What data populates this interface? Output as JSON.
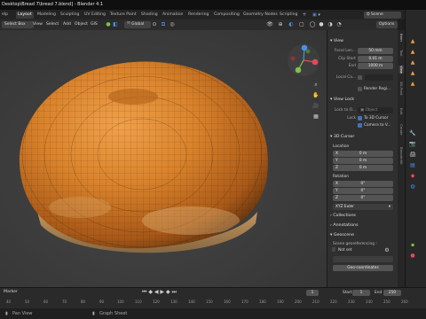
{
  "window": {
    "title": "Desktop\\Bread 7\\bread 7.blend] - Blender 4.1"
  },
  "workspace_tabs": [
    "Layout",
    "Modeling",
    "Sculpting",
    "UV Editing",
    "Texture Paint",
    "Shading",
    "Animation",
    "Rendering",
    "Compositing",
    "Geometry Nodes",
    "Scripting"
  ],
  "active_tab": "Layout",
  "top_right": {
    "scene_label": "Scene"
  },
  "header": {
    "select_box": "Select Box",
    "menus": [
      "View",
      "Select",
      "Add",
      "Object",
      "GIS"
    ],
    "transform_orientation": "Global",
    "options_label": "Options"
  },
  "npanel": {
    "view_section": "View",
    "focal_length_label": "Focal Len...",
    "focal_length_value": "50 mm",
    "clip_start_label": "Clip Start",
    "clip_start_value": "0.01 m",
    "clip_end_label": "End",
    "clip_end_value": "1000 m",
    "local_camera_label": "Local Ca...",
    "render_region_label": "Render Regi...",
    "view_lock_section": "View Lock",
    "lock_to_object_label": "Lock to O...",
    "object_placeholder": "Object",
    "lock_label": "Lock",
    "to_3d_cursor": "To 3D Cursor",
    "camera_to_view": "Camera to V...",
    "cursor_section": "3D Cursor",
    "location_label": "Location",
    "loc_x_label": "X",
    "loc_x": "0 m",
    "loc_y_label": "Y",
    "loc_y": "0 m",
    "loc_z_label": "Z",
    "loc_z": "0 m",
    "rotation_label": "Rotation",
    "rot_x_label": "X",
    "rot_x": "0°",
    "rot_y_label": "Y",
    "rot_y": "0°",
    "rot_z_label": "Z",
    "rot_z": "0°",
    "rotation_mode": "XYZ Euler",
    "collections_section": "Collections",
    "annotations_section": "Annotations",
    "geoscene_section": "Geoscene",
    "geo_label": "Scene georeferencing :",
    "geo_not_set": "Not set",
    "geo_coords_button": "Geo-coordinates",
    "vertical_tabs": [
      "Item",
      "Tool",
      "View",
      "3D-Print",
      "Edit",
      "Create",
      "BlenderKit"
    ]
  },
  "timeline": {
    "marker_menu": "Marker",
    "start_label": "Start",
    "start_value": "1",
    "end_label": "End",
    "end_value": "250",
    "current_frame": "1",
    "ruler": [
      "40",
      "50",
      "60",
      "70",
      "80",
      "90",
      "100",
      "110",
      "120",
      "130",
      "140",
      "150",
      "160",
      "170",
      "180",
      "190",
      "200",
      "210",
      "220",
      "230",
      "240",
      "250",
      "260"
    ]
  },
  "statusbar": {
    "pan_view": "Pan View",
    "graph_label": "Graph Sheet"
  },
  "colors": {
    "accent": "#4772b3",
    "bread_crust": "#d9822b",
    "gizmo_x": "#e8475a",
    "gizmo_y": "#7fc24a",
    "gizmo_z": "#4b8fe8"
  }
}
